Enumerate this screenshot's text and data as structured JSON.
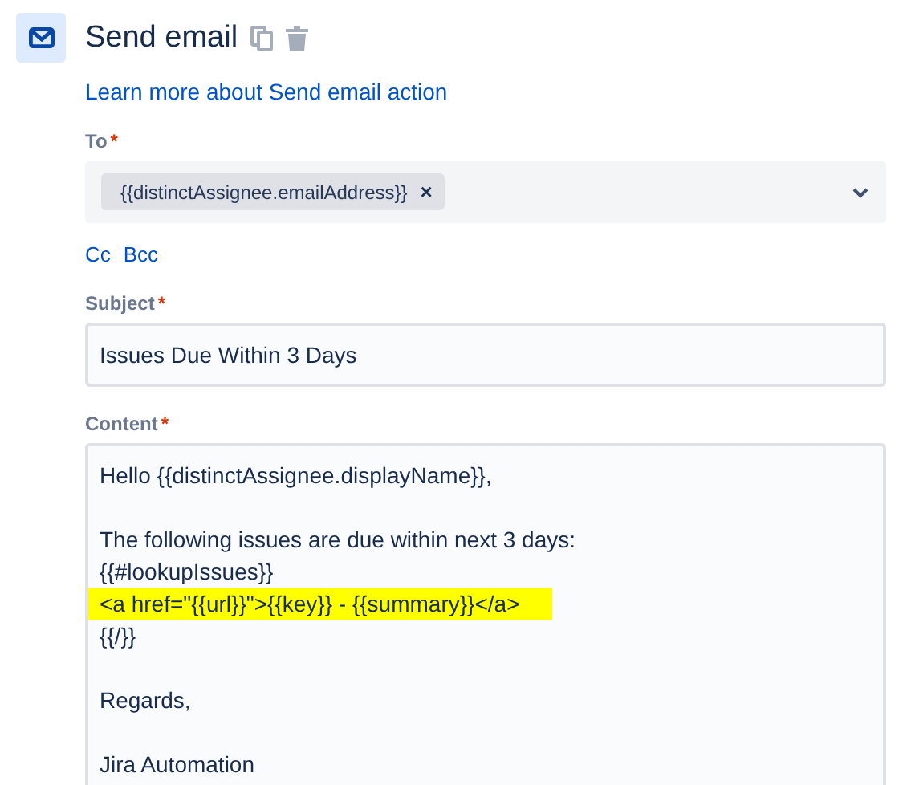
{
  "header": {
    "title": "Send email",
    "learn_more_link": "Learn more about Send email action"
  },
  "to": {
    "label": "To",
    "required_mark": "*",
    "chips": [
      {
        "text": "{{distinctAssignee.emailAddress}}",
        "remove": "×"
      }
    ]
  },
  "cc_links": [
    "Cc",
    "Bcc"
  ],
  "subject": {
    "label": "Subject",
    "required_mark": "*",
    "value": "Issues Due Within 3 Days"
  },
  "content": {
    "label": "Content",
    "required_mark": "*",
    "paragraphs": [
      {
        "lines": [
          {
            "text": "Hello {{distinctAssignee.displayName}},",
            "highlighted": false
          }
        ]
      },
      {
        "lines": [
          {
            "text": "The following issues are due within next 3 days:",
            "highlighted": false
          },
          {
            "text": "{{#lookupIssues}}",
            "highlighted": false
          },
          {
            "text": "<a href=\"{{url}}\">{{key}} - {{summary}}</a>",
            "highlighted": true
          },
          {
            "text": "{{/}}",
            "highlighted": false
          }
        ]
      },
      {
        "lines": [
          {
            "text": "Regards,",
            "highlighted": false
          }
        ]
      },
      {
        "lines": [
          {
            "text": "Jira Automation",
            "highlighted": false
          }
        ]
      }
    ]
  }
}
